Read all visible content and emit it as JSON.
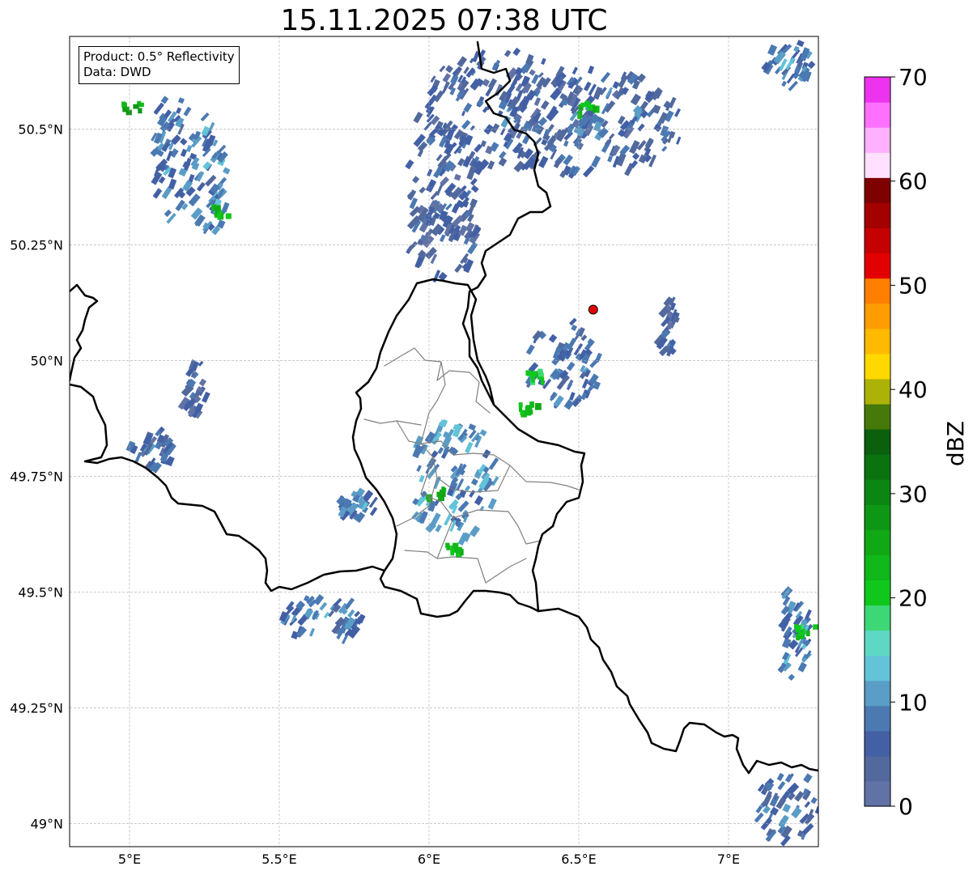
{
  "title": "15.11.2025 07:38 UTC",
  "info": {
    "product": "Product: 0.5° Reflectivity",
    "data": "Data: DWD"
  },
  "map": {
    "lon_range": [
      4.8,
      7.3
    ],
    "lat_range": [
      48.95,
      50.7
    ],
    "x_ticks": [
      {
        "value": 5.0,
        "label": "5°E"
      },
      {
        "value": 5.5,
        "label": "5.5°E"
      },
      {
        "value": 6.0,
        "label": "6°E"
      },
      {
        "value": 6.5,
        "label": "6.5°E"
      },
      {
        "value": 7.0,
        "label": "7°E"
      }
    ],
    "y_ticks": [
      {
        "value": 50.5,
        "label": "50.5°N"
      },
      {
        "value": 50.25,
        "label": "50.25°N"
      },
      {
        "value": 50.0,
        "label": "50°N"
      },
      {
        "value": 49.75,
        "label": "49.75°N"
      },
      {
        "value": 49.5,
        "label": "49.5°N"
      },
      {
        "value": 49.25,
        "label": "49.25°N"
      },
      {
        "value": 49.0,
        "label": "49°N"
      }
    ],
    "grid": true,
    "radar_site": {
      "lon": 6.548,
      "lat": 50.11,
      "color": "#e00000"
    },
    "border_color": "#000000",
    "admin_color": "#808080",
    "echo_regions": [
      {
        "lon": 6.25,
        "lat": 50.55,
        "rlon": 0.3,
        "rlat": 0.13,
        "dbz": 5
      },
      {
        "lon": 6.55,
        "lat": 50.52,
        "rlon": 0.3,
        "rlat": 0.12,
        "dbz": 6
      },
      {
        "lon": 6.05,
        "lat": 50.4,
        "rlon": 0.12,
        "rlat": 0.12,
        "dbz": 5
      },
      {
        "lon": 6.05,
        "lat": 50.27,
        "rlon": 0.12,
        "rlat": 0.08,
        "dbz": 5
      },
      {
        "lon": 5.15,
        "lat": 50.45,
        "rlon": 0.07,
        "rlat": 0.14,
        "dbz": 8
      },
      {
        "lon": 5.27,
        "lat": 50.42,
        "rlon": 0.06,
        "rlat": 0.14,
        "dbz": 9
      },
      {
        "lon": 5.08,
        "lat": 49.82,
        "rlon": 0.08,
        "rlat": 0.04,
        "dbz": 6
      },
      {
        "lon": 5.22,
        "lat": 49.95,
        "rlon": 0.04,
        "rlat": 0.06,
        "dbz": 4
      },
      {
        "lon": 6.08,
        "lat": 49.75,
        "rlon": 0.15,
        "rlat": 0.14,
        "dbz": 10
      },
      {
        "lon": 5.77,
        "lat": 49.7,
        "rlon": 0.07,
        "rlat": 0.03,
        "dbz": 8
      },
      {
        "lon": 6.45,
        "lat": 50.0,
        "rlon": 0.12,
        "rlat": 0.1,
        "dbz": 7
      },
      {
        "lon": 5.65,
        "lat": 49.45,
        "rlon": 0.15,
        "rlat": 0.05,
        "dbz": 8
      },
      {
        "lon": 7.22,
        "lat": 49.42,
        "rlon": 0.06,
        "rlat": 0.1,
        "dbz": 9
      },
      {
        "lon": 7.2,
        "lat": 49.05,
        "rlon": 0.1,
        "rlat": 0.08,
        "dbz": 7
      },
      {
        "lon": 7.2,
        "lat": 50.65,
        "rlon": 0.08,
        "rlat": 0.05,
        "dbz": 8
      },
      {
        "lon": 6.8,
        "lat": 50.08,
        "rlon": 0.03,
        "rlat": 0.07,
        "dbz": 5
      }
    ],
    "echo_cores": [
      {
        "lon": 6.52,
        "lat": 50.55,
        "dbz": 22
      },
      {
        "lon": 5.0,
        "lat": 50.55,
        "dbz": 25
      },
      {
        "lon": 5.3,
        "lat": 50.33,
        "dbz": 22
      },
      {
        "lon": 6.02,
        "lat": 49.72,
        "dbz": 24
      },
      {
        "lon": 6.08,
        "lat": 49.6,
        "dbz": 22
      },
      {
        "lon": 6.33,
        "lat": 49.9,
        "dbz": 22
      },
      {
        "lon": 6.35,
        "lat": 49.97,
        "dbz": 20
      },
      {
        "lon": 7.25,
        "lat": 49.42,
        "dbz": 22
      }
    ]
  },
  "colorbar": {
    "label": "dBZ",
    "min": 0,
    "max": 70,
    "tick_labels": [
      "0",
      "10",
      "20",
      "30",
      "40",
      "50",
      "60",
      "70"
    ],
    "colors": [
      "#6173a6",
      "#52699d",
      "#4360a5",
      "#4b79b2",
      "#5a9dc6",
      "#62c3d9",
      "#5ed8c5",
      "#3ed776",
      "#10c81c",
      "#10b819",
      "#11a816",
      "#0e9715",
      "#0b8612",
      "#0a730f",
      "#0a600d",
      "#457a0a",
      "#adb207",
      "#ffd800",
      "#ffba00",
      "#ff9c00",
      "#ff7f00",
      "#e30000",
      "#c50000",
      "#a30000",
      "#7f0000",
      "#ffe0ff",
      "#ffb0ff",
      "#ff70ff",
      "#ee33ee"
    ]
  }
}
